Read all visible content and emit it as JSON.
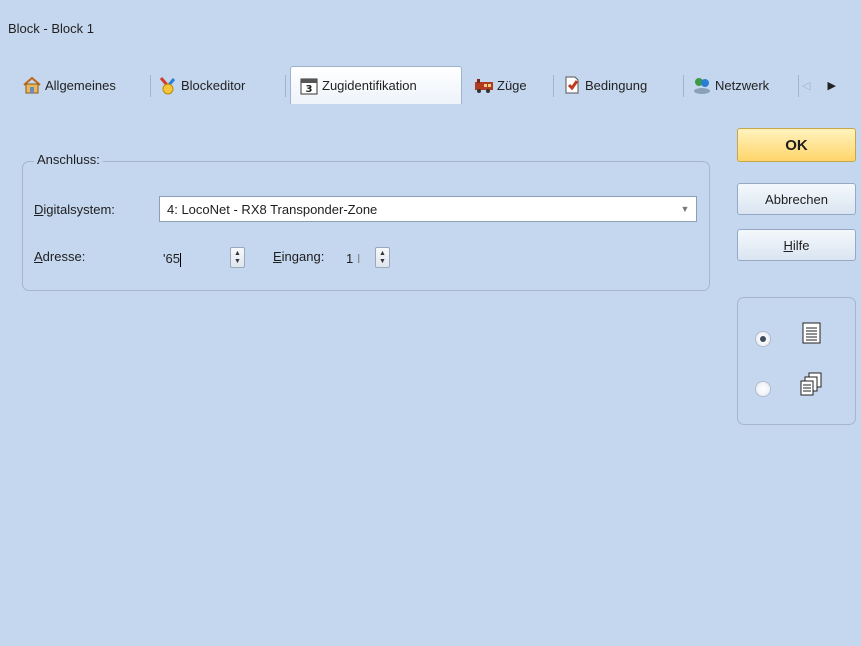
{
  "window": {
    "title": "Block - Block 1"
  },
  "tabs": [
    {
      "label": "Allgemeines",
      "icon": "house-icon"
    },
    {
      "label": "Blockeditor",
      "icon": "block-editor-icon"
    },
    {
      "label": "Zugidentifikation",
      "icon": "calendar-3-icon",
      "active": true
    },
    {
      "label": "Züge",
      "icon": "train-icon"
    },
    {
      "label": "Bedingung",
      "icon": "document-condition-icon"
    },
    {
      "label": "Netzwerk",
      "icon": "network-users-icon"
    }
  ],
  "connection": {
    "group_label": "Anschluss:",
    "digitalsystem_label_first": "D",
    "digitalsystem_label_rest": "igitalsystem:",
    "digitalsystem_value": "4: LocoNet - RX8 Transponder-Zone",
    "address_label_first": "A",
    "address_label_rest": "dresse:",
    "address_value": "'65",
    "input_label_first": "E",
    "input_label_rest": "ingang:",
    "input_value": "1 ",
    "input_value_clip": "I"
  },
  "buttons": {
    "ok": "OK",
    "cancel": "Abbrechen",
    "help_first": "H",
    "help_rest": "ilfe"
  },
  "view_options": [
    {
      "icon": "single-page-icon",
      "selected": true
    },
    {
      "icon": "multi-page-icon",
      "selected": false
    }
  ],
  "colors": {
    "background": "#c4d7ee",
    "ok_button": "#ffd56b"
  }
}
